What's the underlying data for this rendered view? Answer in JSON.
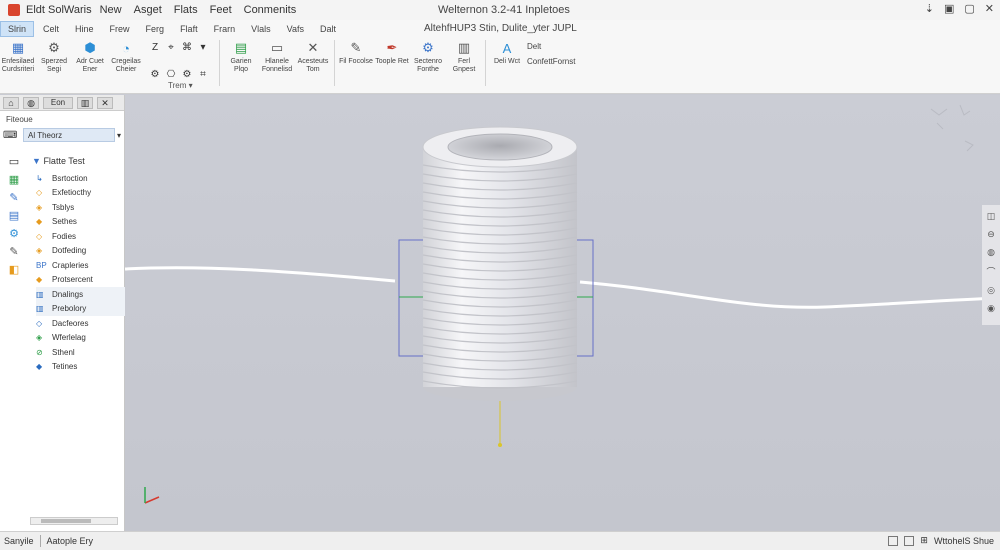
{
  "titlebar": {
    "app_name": "Eldt SolWaris",
    "menus": [
      "New",
      "Asget",
      "Flats",
      "Feet",
      "Conmenits"
    ],
    "window_title": "Welternon 3.2-41 Inpletoes",
    "controls": [
      "⇣",
      "▣",
      "▢",
      "✕"
    ]
  },
  "ribbon": {
    "tabs": [
      "Slrin",
      "Celt",
      "Hine",
      "Frew",
      "Ferg",
      "Flaft",
      "Frarn",
      "Vlals",
      "Vafs",
      "Dalt"
    ],
    "doc_path": "AltehfHUP3 Stin, Dulite_yter JUPL",
    "tools": [
      {
        "icon": "▦",
        "label": "Enfesilaed Curdsriteri",
        "color": "#3b74c9"
      },
      {
        "icon": "⚙",
        "label": "Sperzed Segi",
        "color": "#555"
      },
      {
        "icon": "⬢",
        "label": "Adr Cuet Ener",
        "color": "#2d8fd6"
      },
      {
        "icon": "◔",
        "label": "Cregeilas Cheier",
        "color": "#2d8fd6"
      }
    ],
    "small_icons": [
      "Z",
      "⌖",
      "⌘",
      "▾",
      "⚙",
      "⎔",
      "⚙",
      "⌗"
    ],
    "group_label": "Trem   ▾",
    "tools2": [
      {
        "icon": "▤",
        "label": "Garien Plqo",
        "color": "#2f9e49"
      },
      {
        "icon": "▭",
        "label": "Hlanele Fonnelisd",
        "color": "#555"
      },
      {
        "icon": "✕",
        "label": "Acesteuts Tom",
        "color": "#555"
      },
      {
        "icon": "✎",
        "label": "Fil Focolse",
        "color": "#555"
      },
      {
        "icon": "✒",
        "label": "Toople Ret",
        "color": "#c0392b"
      },
      {
        "icon": "⚙",
        "label": "Sectenro Fonthe",
        "color": "#3b74c9"
      },
      {
        "icon": "▥",
        "label": "Ferl Gnpest",
        "color": "#555"
      },
      {
        "icon": "A",
        "label": "Deli Wct",
        "color": "#2d8fd6"
      }
    ],
    "extra_top": "Delt",
    "extra_label": "ConfettFornst"
  },
  "left_panel": {
    "tabs": [
      "⌂",
      "◍",
      "Eon",
      "▥",
      "✕"
    ],
    "label": "Fiteoue",
    "filter_icon": "⌨",
    "filter_value": "Al Theorz",
    "filter_arrow": "▾",
    "vtools": [
      "▭",
      "▦",
      "✎",
      "▤",
      "⚙",
      "✎",
      "◧"
    ],
    "tree_root": "Flatte Test",
    "tree_items": [
      {
        "icon": "↳",
        "label": "Bsrtoction"
      },
      {
        "icon": "◇",
        "label": "Exfetiocthy"
      },
      {
        "icon": "◈",
        "label": "Tsblys"
      },
      {
        "icon": "◆",
        "label": "Sethes"
      },
      {
        "icon": "◇",
        "label": "Fodies"
      },
      {
        "icon": "◈",
        "label": "Dotfeding"
      },
      {
        "icon": "BP",
        "label": "Crapleries"
      },
      {
        "icon": "◆",
        "label": "Protsercent"
      },
      {
        "icon": "▥",
        "label": "Dnalings"
      },
      {
        "icon": "▥",
        "label": "Prebolory"
      },
      {
        "icon": "◇",
        "label": "Dacfeores"
      },
      {
        "icon": "◈",
        "label": "Wferlelag"
      },
      {
        "icon": "⊘",
        "label": "Sthenl"
      },
      {
        "icon": "◆",
        "label": "Tetines"
      }
    ]
  },
  "viewport": {
    "right_tools": [
      "◫",
      "⊖",
      "◍",
      "⌒",
      "◎",
      "◉"
    ]
  },
  "statusbar": {
    "left": "Sanyile",
    "mid": "Aatople Ery",
    "right": "WttohelS Shue",
    "zoom": "⊞"
  },
  "colors": {
    "accent": "#cfe3f7",
    "viewport_bg": "#c8cad2",
    "sketch_box": "#6670c7",
    "axis_red": "#d63a2f",
    "axis_green": "#2ea84d",
    "axis_yellow": "#d9c52b"
  }
}
